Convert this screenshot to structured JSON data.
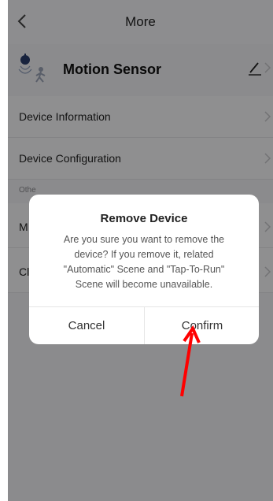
{
  "header": {
    "title": "More"
  },
  "device": {
    "name": "Motion Sensor"
  },
  "list": [
    {
      "label": "Device Information"
    },
    {
      "label": "Device Configuration"
    }
  ],
  "section": {
    "label": "Othe"
  },
  "list2": [
    {
      "label": "M"
    },
    {
      "label": "Cl"
    }
  ],
  "dialog": {
    "title": "Remove Device",
    "message_lines": [
      "Are you sure you want to remove the",
      "device? If you remove it, related",
      "\"Automatic\" Scene  and \"Tap-To-Run\"",
      "Scene will become unavailable."
    ],
    "cancel_label": "Cancel",
    "confirm_label": "Confirm"
  },
  "annotation": {
    "color": "#ff0000"
  },
  "colors": {
    "overlay": "rgba(0,0,0,0.42)",
    "dialog_bg": "#ffffff"
  }
}
